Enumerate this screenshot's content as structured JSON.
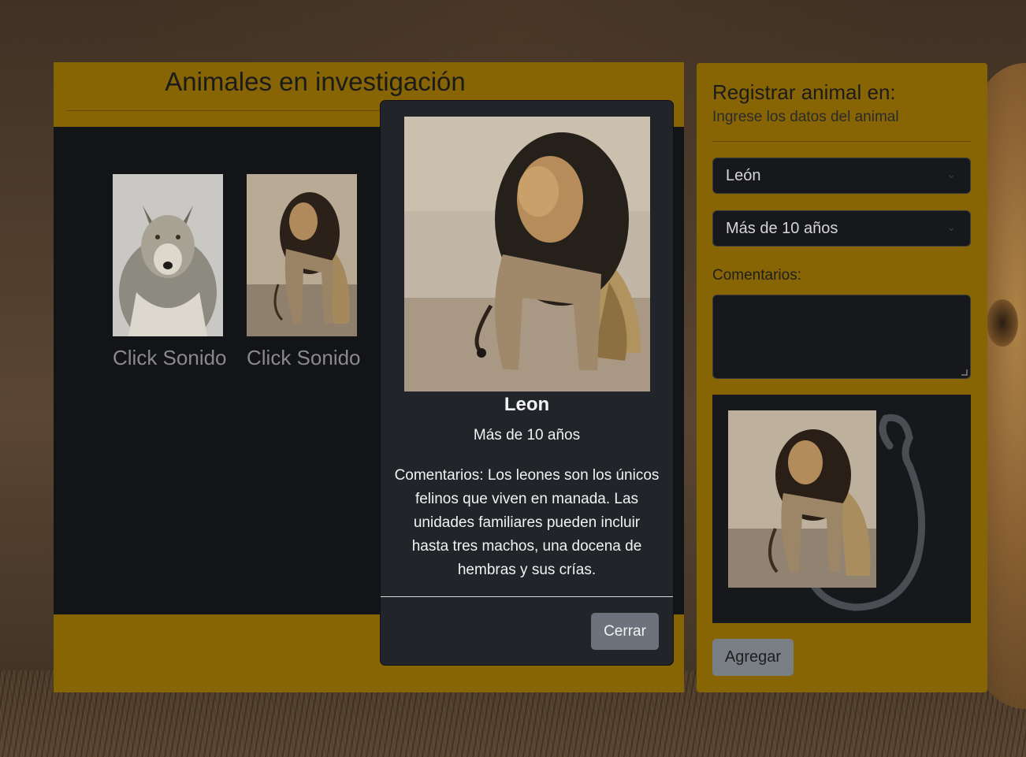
{
  "gallery": {
    "title": "Animales en investigación",
    "cards": [
      {
        "animal": "wolf",
        "caption": "Click Sonido"
      },
      {
        "animal": "lion",
        "caption": "Click Sonido"
      }
    ]
  },
  "form": {
    "title": "Registrar animal en:",
    "subtitle": "Ingrese los datos del animal",
    "animal_select": "León",
    "age_select": "Más de 10 años",
    "comments_label": "Comentarios:",
    "comments_value": "",
    "add_label": "Agregar"
  },
  "modal": {
    "name": "Leon",
    "age": "Más de 10 años",
    "comment": "Comentarios: Los leones son los únicos felinos que viven en manada. Las unidades familiares pueden incluir hasta tres machos, una docena de hembras y sus crías.",
    "close_label": "Cerrar"
  },
  "colors": {
    "panel": "#876505",
    "dark": "#121417",
    "modal": "#212529",
    "button": "#6c737c"
  },
  "icons": [
    "chevron-down-icon",
    "chevron-down-icon",
    "lion-outline-icon"
  ]
}
